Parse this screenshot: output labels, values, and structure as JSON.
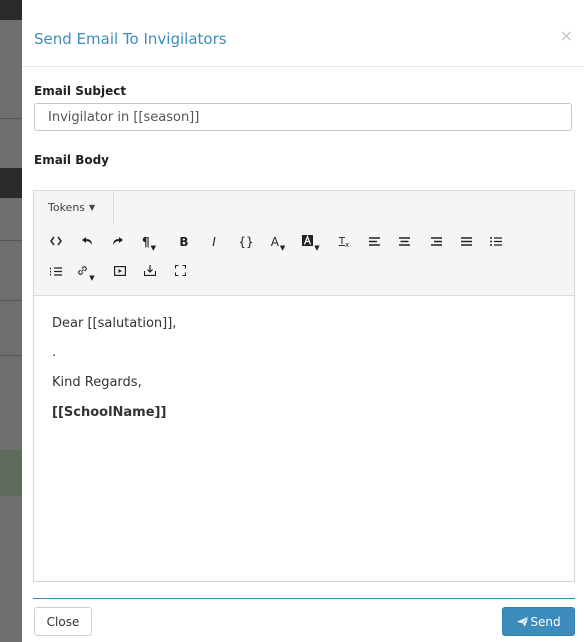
{
  "modal": {
    "title": "Send Email To Invigilators",
    "close_icon": "×"
  },
  "form": {
    "subject_label": "Email Subject",
    "subject_value": "Invigilator in [[season]]",
    "body_label": "Email Body"
  },
  "editor": {
    "tokens_label": "Tokens",
    "toolbar_icons": [
      "code-view-icon",
      "undo-icon",
      "redo-icon",
      "paragraph-style-icon",
      "bold-icon",
      "italic-icon",
      "code-icon",
      "font-color-icon",
      "highlight-color-icon",
      "clear-format-icon",
      "align-left-icon",
      "align-center-icon",
      "align-right-icon",
      "align-justify-icon",
      "unordered-list-icon",
      "ordered-list-icon",
      "link-icon",
      "video-icon",
      "download-icon",
      "fullscreen-icon"
    ],
    "body_lines": [
      "Dear [[salutation]],",
      ".",
      "Kind Regards,",
      "[[SchoolName]]"
    ]
  },
  "footer": {
    "close_label": "Close",
    "send_label": "Send"
  },
  "colors": {
    "accent": "#3c8dbc",
    "send_button": "#3c8dbc"
  }
}
